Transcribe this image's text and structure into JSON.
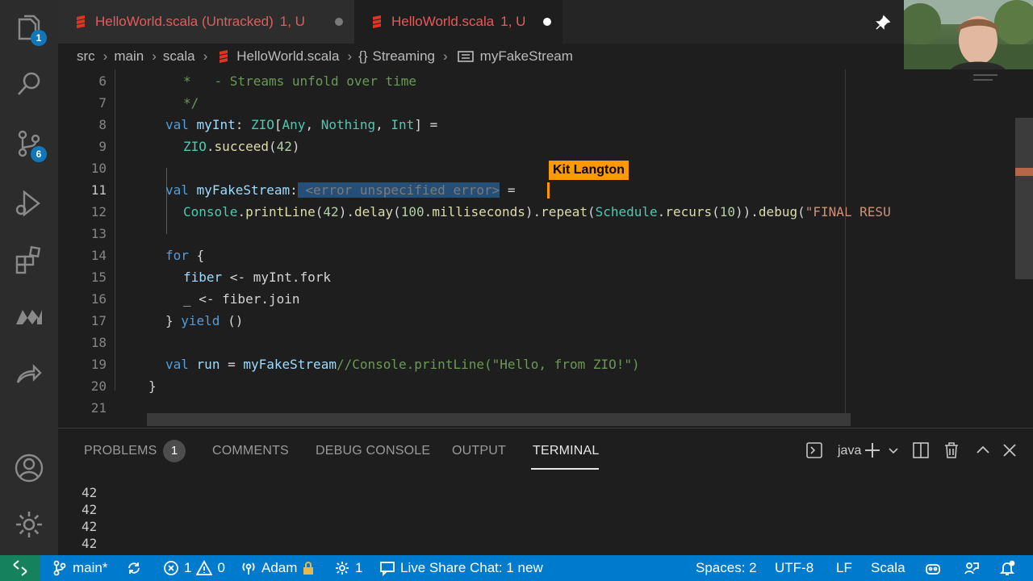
{
  "activity_bar": {
    "explorer_badge": "1",
    "source_control_badge": "6"
  },
  "tabs": [
    {
      "label": "HelloWorld.scala (Untracked)",
      "status": "1, U"
    },
    {
      "label": "HelloWorld.scala",
      "status": "1, U"
    }
  ],
  "breadcrumb": {
    "items": [
      "src",
      "main",
      "scala",
      "HelloWorld.scala",
      "Streaming",
      "myFakeStream"
    ]
  },
  "editor": {
    "line_numbers": [
      "6",
      "7",
      "8",
      "9",
      "10",
      "11",
      "12",
      "13",
      "14",
      "15",
      "16",
      "17",
      "18",
      "19",
      "20",
      "21"
    ],
    "active_line": "11",
    "collaborator_tag": "Kit Langton",
    "lines": {
      "l6": "*   - Streams unfold over time",
      "l7": "*/",
      "l8_kw": "val",
      "l8_name": "myInt",
      "l8_colon": ": ",
      "l8_zio": "ZIO",
      "l8_b1": "[",
      "l8_any": "Any",
      "l8_c1": ", ",
      "l8_nothing": "Nothing",
      "l8_c2": ", ",
      "l8_int": "Int",
      "l8_rest": "] =",
      "l9_zio": "ZIO",
      "l9_dot": ".",
      "l9_fn": "succeed",
      "l9_p1": "(",
      "l9_num": "42",
      "l9_p2": ")",
      "l11_kw": "val",
      "l11_name": "myFakeStream",
      "l11_colon": ":",
      "l11_hint": " <error unspecified error>",
      "l11_eq": "=",
      "l12_console": "Console",
      "l12_a": ".",
      "l12_println": "printLine",
      "l12_b": "(",
      "l12_n42": "42",
      "l12_c": ").",
      "l12_delay": "delay",
      "l12_d": "(",
      "l12_n100": "100",
      "l12_e": ".",
      "l12_ms": "milliseconds",
      "l12_f": ").",
      "l12_repeat": "repeat",
      "l12_g": "(",
      "l12_schedule": "Schedule",
      "l12_h": ".",
      "l12_recurs": "recurs",
      "l12_i": "(",
      "l12_n10": "10",
      "l12_j": ")).",
      "l12_debug": "debug",
      "l12_k": "(",
      "l12_str": "\"FINAL RESU",
      "l14_kw": "for",
      "l14_rest": " {",
      "l15_var": "fiber",
      "l15_rest": " <- myInt.fork",
      "l16": "_ <- fiber.join",
      "l17_a": "} ",
      "l17_kw": "yield",
      "l17_b": " ()",
      "l19_kw": "val",
      "l19_name": "run",
      "l19_eq": " = ",
      "l19_ref": "myFakeStream",
      "l19_cm": "//Console.printLine(\"Hello, from ZIO!\")",
      "l20": "}"
    }
  },
  "panel": {
    "tabs": {
      "problems": "PROBLEMS",
      "problems_count": "1",
      "comments": "COMMENTS",
      "debug_console": "DEBUG CONSOLE",
      "output": "OUTPUT",
      "terminal": "TERMINAL"
    },
    "active_tab": "TERMINAL",
    "terminal_kind": "java",
    "terminal_output": [
      "42",
      "42",
      "42",
      "42"
    ]
  },
  "status_bar": {
    "branch": "main*",
    "errors": "1",
    "warnings": "0",
    "user": "Adam",
    "ports": "1",
    "live_share": "Live Share Chat: 1 new",
    "spaces": "Spaces: 2",
    "encoding": "UTF-8",
    "eol": "LF",
    "language": "Scala"
  },
  "colors": {
    "accent": "#007acc",
    "remote": "#16825d",
    "collaborator": "#ff9900",
    "tab_text": "#e75a5a"
  }
}
